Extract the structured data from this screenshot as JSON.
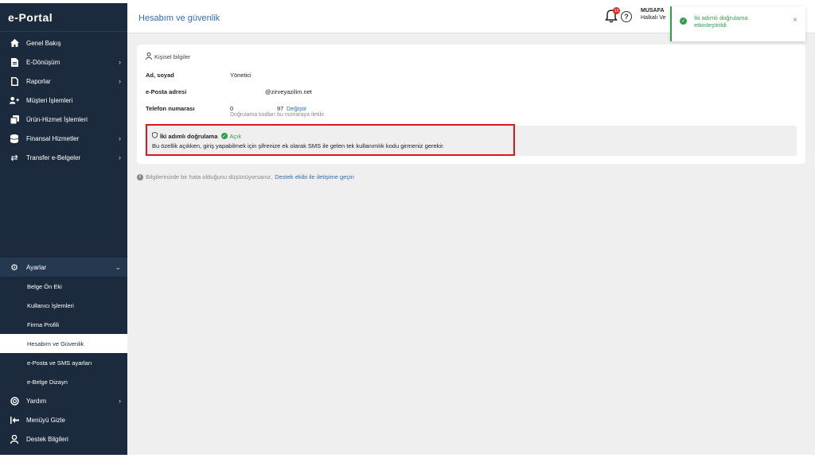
{
  "logo": "e-Portal",
  "sidebar": {
    "items": [
      {
        "label": "Genel Bakış",
        "icon": "home-icon",
        "chevron": false
      },
      {
        "label": "E-Dönüşüm",
        "icon": "document-icon",
        "chevron": true
      },
      {
        "label": "Raporlar",
        "icon": "file-icon",
        "chevron": true
      },
      {
        "label": "Müşteri İşlemleri",
        "icon": "add-user-icon",
        "chevron": false
      },
      {
        "label": "Ürün-Hizmet İşlemleri",
        "icon": "copy-icon",
        "chevron": false
      },
      {
        "label": "Finansal Hizmetler",
        "icon": "database-icon",
        "chevron": true
      },
      {
        "label": "Transfer e-Belgeler",
        "icon": "transfer-icon",
        "chevron": true
      }
    ],
    "settings": {
      "label": "Ayarlar",
      "icon": "gear-icon",
      "subitems": [
        "Belge Ön Eki",
        "Kullanıcı İşlemleri",
        "Firma Profili",
        "Hesabım ve Güvenlik",
        "e-Posta ve SMS ayarları",
        "e-Belge Dizayn"
      ],
      "active_index": 3
    },
    "bottom": [
      {
        "label": "Yardım",
        "icon": "help-icon",
        "chevron": true
      },
      {
        "label": "Menüyü Gizle",
        "icon": "collapse-icon",
        "chevron": false
      },
      {
        "label": "Destek Bilgileri",
        "icon": "support-icon",
        "chevron": false
      }
    ]
  },
  "header": {
    "title": "Hesabım ve güvenlik",
    "user_name": "MUSAFA",
    "user_sub": "Halkalı Ve",
    "notification_count": "12"
  },
  "personal": {
    "section_title": "Kişisel bilgiler",
    "name_label": "Ad, soyad",
    "name_value": "Yönetici",
    "email_label": "e-Posta adresi",
    "email_value": "@zirveyazilim.net",
    "phone_label": "Telefon numarası",
    "phone_prefix": "0",
    "phone_suffix": "97",
    "phone_change": "Değiştir",
    "phone_hint": "Doğrulama kodları bu numaraya iletilir."
  },
  "tfa": {
    "title": "İki adımlı doğrulama",
    "state": "Açık",
    "description": "Bu özellik açıkken, giriş yapabilmek için şifrenize ek olarak SMS ile gelen tek kullanımlık kodu girmeniz gerekir."
  },
  "info": {
    "text": "Bilgilerinizde bir hata olduğunu düşünüyorsanız,",
    "link": "Destek ekibi ile iletişime geçin"
  },
  "toast": {
    "message": "İki adımlı doğrulama etkinleştirildi",
    "close": "×"
  },
  "colors": {
    "sidebar_bg": "#1b2b3d",
    "accent": "#2f6db5",
    "success": "#2e9e4f",
    "highlight": "#e0141e"
  }
}
